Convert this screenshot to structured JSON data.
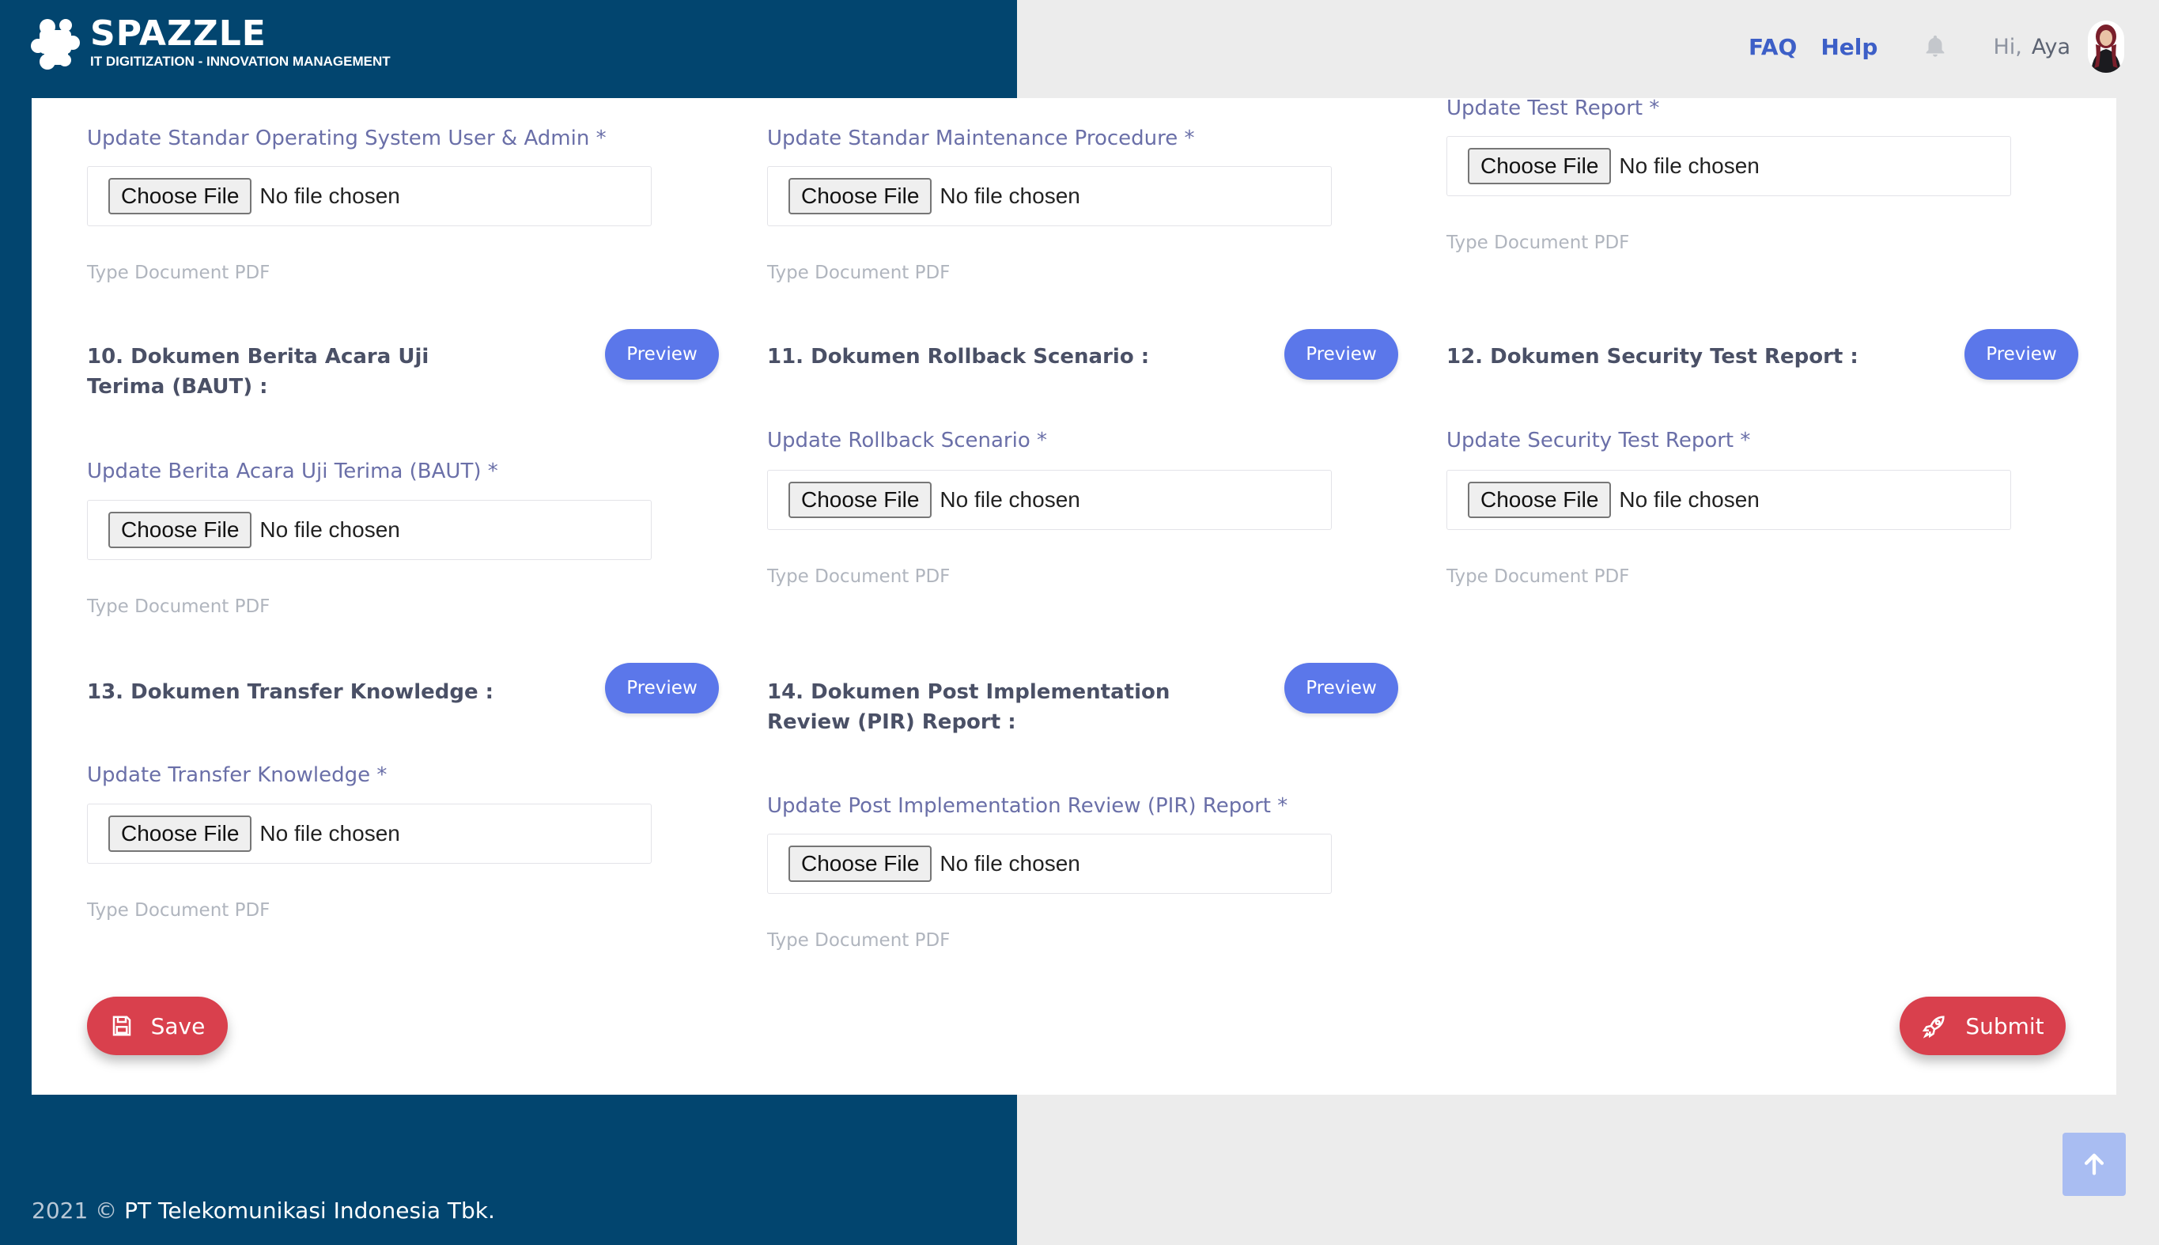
{
  "header": {
    "brand_name": "SPAZZLE",
    "brand_tagline": "IT DIGITIZATION - INNOVATION MANAGEMENT",
    "nav": [
      "FAQ",
      "Help"
    ],
    "greeting": "Hi,",
    "user_name": "Aya"
  },
  "file_input": {
    "button_label": "Choose File",
    "empty_text": "No file chosen",
    "hint": "Type Document PDF"
  },
  "preview_label": "Preview",
  "fields": {
    "sop": "Update Standar Operating System User & Admin *",
    "smp": "Update Standar Maintenance Procedure *",
    "test_report": "Update Test Report *",
    "baut": "Update Berita Acara Uji Terima (BAUT) *",
    "rollback": "Update Rollback Scenario *",
    "security": "Update Security Test Report *",
    "transfer": "Update Transfer Knowledge *",
    "pir": "Update Post Implementation Review (PIR) Report *"
  },
  "sections": {
    "s10": "10. Dokumen Berita Acara Uji Terima (BAUT) :",
    "s11": "11. Dokumen Rollback Scenario :",
    "s12": "12. Dokumen Security Test Report :",
    "s13": "13. Dokumen Transfer Knowledge :",
    "s14": "14. Dokumen Post Implementation Review (PIR) Report :"
  },
  "actions": {
    "save": "Save",
    "submit": "Submit"
  },
  "footer": {
    "year": "2021 ©",
    "company": "PT Telekomunikasi Indonesia Tbk."
  },
  "colors": {
    "sidebar": "#02456f",
    "primary": "#5b77ea",
    "danger": "#d9404d",
    "link": "#3d5fc7"
  }
}
